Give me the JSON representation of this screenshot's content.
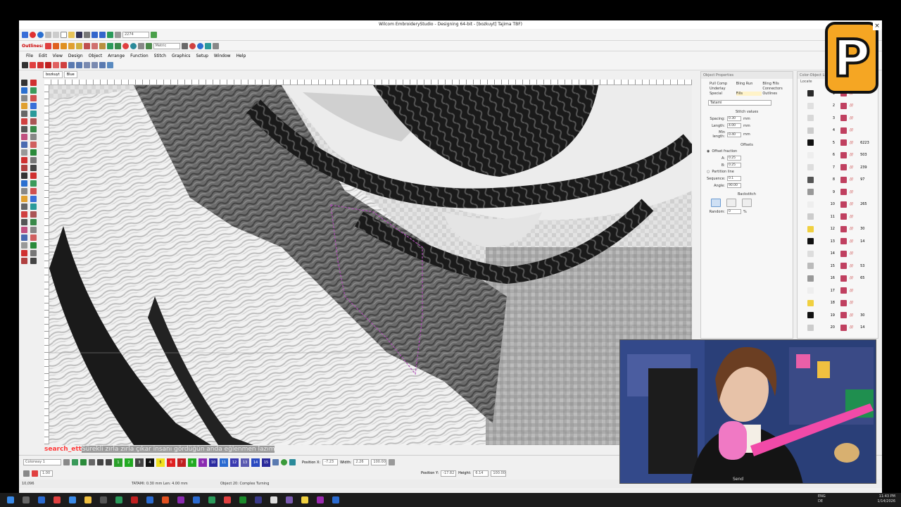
{
  "window": {
    "title": "Wilcom EmbroideryStudio - Designing 64-bit - [bozkuyt] Tajima TBF)"
  },
  "toolbar": {
    "outlines_label": "Outlines:",
    "field_value": "2274",
    "metric_label": "Metric"
  },
  "menu": [
    "File",
    "Edit",
    "View",
    "Design",
    "Object",
    "Arrange",
    "Function",
    "Stitch",
    "Graphics",
    "Setup",
    "Window",
    "Help"
  ],
  "doc_tabs": [
    "bozkuyt",
    "Blue"
  ],
  "object_properties": {
    "title": "Object Properties",
    "tabs": [
      "Pull Comp",
      "Bling Run",
      "Bling Fills",
      "Underlay",
      "",
      "Connectors",
      "Special",
      "Fills",
      "Outlines"
    ],
    "active_tab": "Fills",
    "fill_type": "Tatami",
    "stitch_values_label": "Stitch values",
    "spacing_label": "Spacing:",
    "spacing_value": "0.30",
    "length_label": "Length:",
    "length_value": "4.00",
    "min_length_label": "Min length:",
    "min_length_value": "0.40",
    "unit": "mm",
    "offsets_label": "Offsets",
    "offset_fraction_label": "Offset fraction",
    "a_label": "A:",
    "a_value": "0.25",
    "b_label": "B:",
    "b_value": "0.25",
    "partition_label": "Partition line",
    "sequence_label": "Sequence:",
    "sequence_value": "0.1",
    "angle_label": "Angle:",
    "angle_value": "90.00",
    "backstitch_label": "Backstitch",
    "random_label": "Random:",
    "random_value": "0",
    "percent": "%"
  },
  "color_object_list": {
    "title": "Color-Object List",
    "tab": "Locate",
    "rows": [
      "1",
      "2",
      "3",
      "4",
      "5",
      "6",
      "7",
      "8",
      "9",
      "10",
      "11",
      "12",
      "13",
      "14",
      "15",
      "16",
      "17",
      "18",
      "19",
      "20"
    ],
    "counts": [
      "",
      "",
      "",
      "",
      "6223",
      "503",
      "239",
      "97",
      "",
      "265",
      "",
      "30",
      "14",
      "",
      "53",
      "65",
      "",
      "",
      "30",
      "14"
    ]
  },
  "bottom": {
    "colorway": "Colorway 1",
    "zoom": "1.00",
    "position_x_label": "Position X:",
    "position_x": "-7.23",
    "position_y_label": "Position Y:",
    "position_y": "-17.82",
    "width_label": "Width:",
    "width": "2.26",
    "height_label": "Height:",
    "height": "6.14",
    "percent_w": "100.00",
    "percent_h": "100.00",
    "mm": "mm"
  },
  "swatches": [
    "1",
    "2",
    "3",
    "4",
    "5",
    "6",
    "7",
    "8",
    "9",
    "10",
    "11",
    "12",
    "13",
    "14",
    "15"
  ],
  "status": {
    "coords": "10,096",
    "stitch_info": "TATAMI: 0.30 mm Len: 4.00 mm",
    "object_info": "Object 20: Complex Turning"
  },
  "chat": {
    "user": "search_ett",
    "message": "Sürekli zırla zırla çıkar insanı gördüğün anda eğlenmen lazım"
  },
  "taskbar": {
    "lang": "ENG",
    "region": "DE",
    "time": "11:43 PM",
    "date": "1/14/2026"
  },
  "webcam_footer": "Send"
}
